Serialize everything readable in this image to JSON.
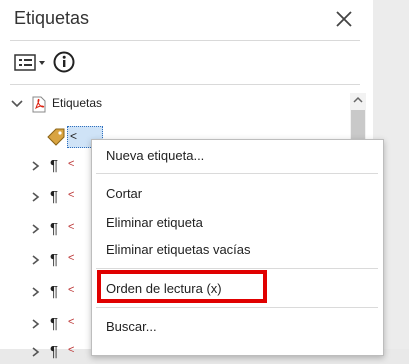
{
  "panel": {
    "title": "Etiquetas",
    "close_icon": "close-icon",
    "options_icon": "options-menu-icon",
    "info_icon": "info-icon"
  },
  "tree": {
    "root_label": "Etiquetas",
    "root_icon": "pdf-file-icon",
    "selected_node_text": "<",
    "tag_icon": "tag-icon",
    "child_rows": [
      {
        "para": "¶",
        "text": "<"
      },
      {
        "para": "¶",
        "text": "<"
      },
      {
        "para": "¶",
        "text": "<"
      },
      {
        "para": "¶",
        "text": "<"
      },
      {
        "para": "¶",
        "text": "<"
      },
      {
        "para": "¶",
        "text": "<"
      },
      {
        "para": "¶",
        "text": "<"
      }
    ]
  },
  "menu": {
    "items": [
      "Nueva etiqueta...",
      "Cortar",
      "Eliminar etiqueta",
      "Eliminar etiquetas vacías",
      "Orden de lectura (x)",
      "Buscar..."
    ]
  },
  "highlight_color": "#e00000"
}
